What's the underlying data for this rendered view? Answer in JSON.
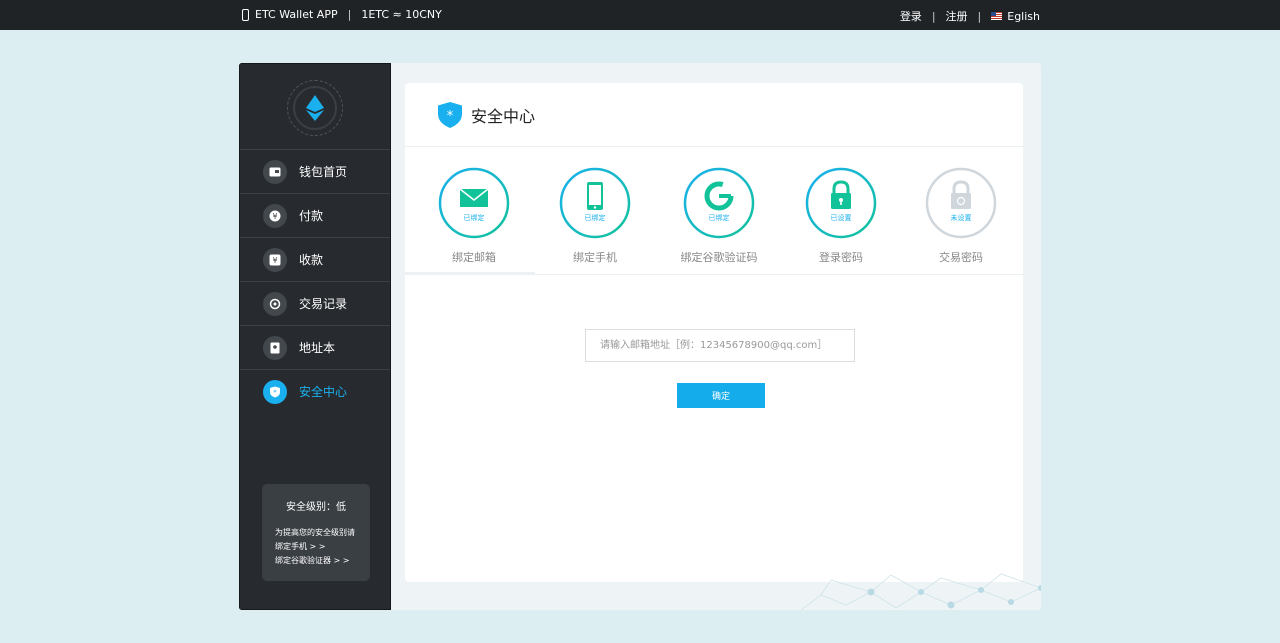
{
  "topbar": {
    "app_label": "ETC Wallet APP",
    "separator": "|",
    "rate": "1ETC ≈ 10CNY",
    "login": "登录",
    "register": "注册",
    "language": "Eglish"
  },
  "sidebar": {
    "items": [
      {
        "label": "钱包首页",
        "icon": "wallet-icon"
      },
      {
        "label": "付款",
        "icon": "payment-icon"
      },
      {
        "label": "收款",
        "icon": "receive-icon"
      },
      {
        "label": "交易记录",
        "icon": "transaction-icon"
      },
      {
        "label": "地址本",
        "icon": "address-book-icon"
      },
      {
        "label": "安全中心",
        "icon": "shield-icon",
        "active": true
      }
    ],
    "level_box": {
      "title": "安全级别：低",
      "line1": "为提高您的安全级别请",
      "line2": "绑定手机 > >",
      "line3": "绑定谷歌验证器 > >"
    }
  },
  "card": {
    "title": "安全中心",
    "steps": [
      {
        "label": "绑定邮箱",
        "status": "已绑定",
        "icon": "mail-icon"
      },
      {
        "label": "绑定手机",
        "status": "已绑定",
        "icon": "phone-icon"
      },
      {
        "label": "绑定谷歌验证码",
        "status": "已绑定",
        "icon": "google-icon"
      },
      {
        "label": "登录密码",
        "status": "已设置",
        "icon": "lock-icon"
      },
      {
        "label": "交易密码",
        "status": "未设置",
        "icon": "lock-icon"
      }
    ],
    "email_placeholder": "请输入邮箱地址［例：12345678900@qq.com］",
    "confirm_label": "确定"
  },
  "colors": {
    "accent": "#1ab0ef",
    "green": "#12c39a",
    "inactive": "#cfd6dc"
  }
}
